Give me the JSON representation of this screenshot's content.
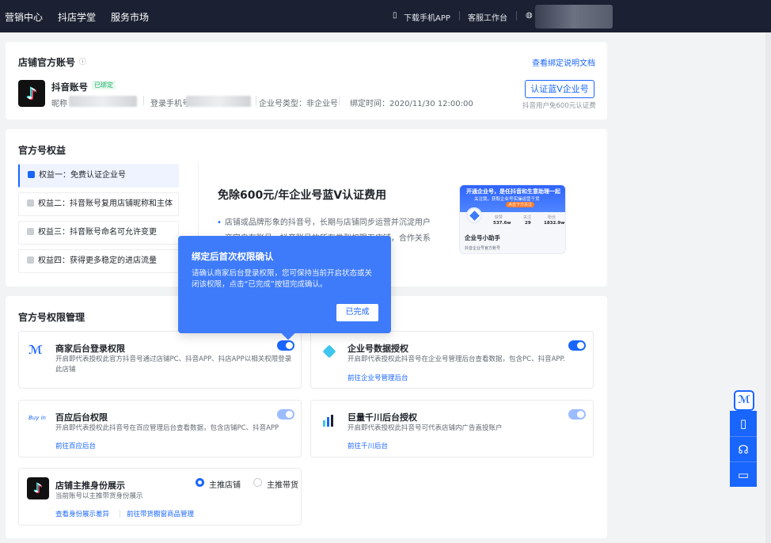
{
  "topbar": {
    "nav": [
      "营销中心",
      "抖店学堂",
      "服务市场"
    ],
    "download_app": "下载手机APP",
    "service_desk": "客服工作台"
  },
  "account_card": {
    "title": "店铺官方账号",
    "doc_link": "查看绑定说明文档",
    "account_name": "抖音账号",
    "badge": "已绑定",
    "nickname_label": "昵称",
    "phone_label": "登录手机号",
    "type": "企业号类型：非企业号",
    "bind_time": "绑定时间：2020/11/30 12:00:00",
    "verify_button": "认证蓝V企业号",
    "verify_note": "抖音用户免600元认证费"
  },
  "rights_card": {
    "title": "官方号权益",
    "benefits": [
      "权益一：免费认证企业号",
      "权益二：抖音账号复用店铺昵称和主体",
      "权益三：抖音账号命名可允许变更",
      "权益四：获得更多稳定的进店流量"
    ],
    "headline": "免除600元/年企业号蓝V认证费用",
    "points": [
      "店铺或品牌形象的抖音号，长期与店铺同步运营并沉淀用户",
      "商家自有账号，抖音账号的所有类型权限无店铺，合作关系"
    ],
    "promo": {
      "banner": "开通企业号，是任抖音和生意助理一起",
      "sub": "关注我，获取企业号实操运营干货",
      "button": "点击下方关注",
      "stats": [
        {
          "label": "获赞",
          "value": "537.6w"
        },
        {
          "label": "关注",
          "value": "29"
        },
        {
          "label": "粉丝",
          "value": "1832.9w"
        }
      ],
      "name": "企业号小助手",
      "tag": "抖音企业号官方账号"
    }
  },
  "perm_card": {
    "title": "官方号权限管理",
    "items": [
      {
        "title": "商家后台登录权限",
        "desc": "开启即代表授权此官方抖音号通过店铺PC、抖音APP、抖店APP以相关权限登录此店铺",
        "link": ""
      },
      {
        "title": "企业号数据授权",
        "desc": "开启即代表授权此抖音号在企业号管理后台查看数据，包含PC、抖音APP.",
        "link": "前往企业号管理后台"
      },
      {
        "title": "百应后台权限",
        "desc": "开启即代表授权此抖音号在百应管理后台查看数据，包含店铺PC、抖音APP",
        "link": "前往百应后台"
      },
      {
        "title": "巨量千川后台授权",
        "desc": "开启即代表授权此抖音号可代表店铺内广告直投账户",
        "link": "前往千川后台"
      },
      {
        "title": "店铺主推身份展示",
        "desc": "当前账号以主推带货身份展示",
        "link": "查看身份展示差异",
        "link2": "前往带货橱窗商品管理"
      }
    ],
    "radio": [
      "主推店铺",
      "主推带货"
    ]
  },
  "popover": {
    "title": "绑定后首次权限确认",
    "body": "请确认商家后台登录权限，您可保持当前开启状态或关闭该权限，点击“已完成”按钮完成确认。",
    "button": "已完成"
  },
  "icons": {
    "buyin_logo": "Buy in",
    "colors": {
      "primary": "#1966ff",
      "topbar": "#1b2132",
      "popover": "#3e7bfa"
    }
  }
}
